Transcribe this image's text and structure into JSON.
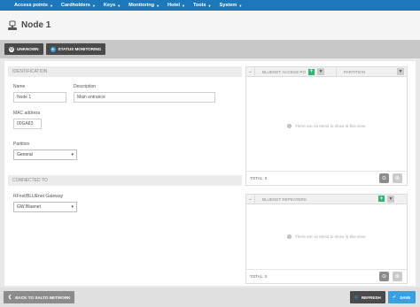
{
  "nav": {
    "items": [
      {
        "label": "Access points"
      },
      {
        "label": "Cardholders"
      },
      {
        "label": "Keys"
      },
      {
        "label": "Monitoring"
      },
      {
        "label": "Hotel"
      },
      {
        "label": "Tools"
      },
      {
        "label": "System"
      }
    ]
  },
  "page": {
    "title": "Node 1"
  },
  "status": {
    "unknown_label": "Unknown",
    "monitoring_label": "Status monitoring"
  },
  "identification": {
    "section_title": "Identification",
    "name_label": "Name",
    "name_value": "Node 1",
    "description_label": "Description",
    "description_value": "Main entrance",
    "mac_label": "MAC address",
    "mac_value": "00GA83",
    "partition_label": "Partition",
    "partition_value": "General"
  },
  "connected": {
    "section_title": "Connected to",
    "gateway_label": "RFnet/BLUEnet Gateway",
    "gateway_value": "GW Bluenet"
  },
  "panel_access": {
    "col1": "BLUEnet Access Po",
    "col2": "Partition",
    "empty_text": "There are no items to show in this view.",
    "total_label": "TOTAL: 0"
  },
  "panel_repeaters": {
    "col1": "BLUEnet Repeaters",
    "empty_text": "There are no items to show in this view.",
    "total_label": "TOTAL: 0"
  },
  "footer": {
    "back_label": "Back to Salto Network",
    "refresh_label": "Refresh",
    "save_label": "Save"
  },
  "colors": {
    "nav_bg": "#1c78ba",
    "add_green": "#2bb673",
    "save_blue": "#3aa0e0",
    "dark_button": "#4a4a4a"
  }
}
